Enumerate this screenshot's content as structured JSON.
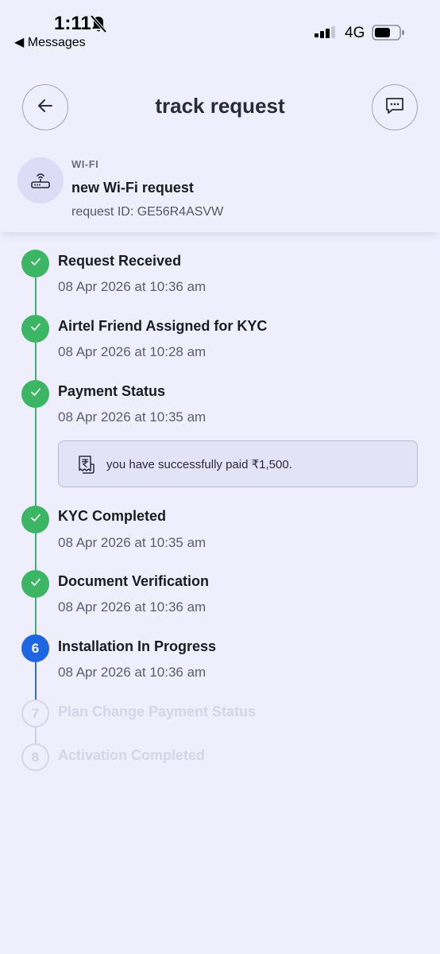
{
  "status_bar": {
    "time": "1:11",
    "back_app": "◀ Messages",
    "network": "4G"
  },
  "header": {
    "title": "track request"
  },
  "request": {
    "category": "WI-FI",
    "name": "new Wi-Fi request",
    "request_id": "request ID: GE56R4ASVW"
  },
  "steps": [
    {
      "number": "1",
      "title": "Request Received",
      "time": "08 Apr 2026 at 10:36 am",
      "state": "done"
    },
    {
      "number": "2",
      "title": "Airtel Friend Assigned for KYC",
      "time": "08 Apr 2026 at 10:28 am",
      "state": "done"
    },
    {
      "number": "3",
      "title": "Payment Status",
      "time": "08 Apr 2026 at 10:35 am",
      "state": "done"
    },
    {
      "number": "4",
      "title": "KYC Completed",
      "time": "08 Apr 2026 at 10:35 am",
      "state": "done"
    },
    {
      "number": "5",
      "title": "Document Verification",
      "time": "08 Apr 2026 at 10:36 am",
      "state": "done"
    },
    {
      "number": "6",
      "title": "Installation In Progress",
      "time": "08 Apr 2026 at 10:36 am",
      "state": "active"
    },
    {
      "number": "7",
      "title": "Plan Change Payment Status",
      "state": "pending"
    },
    {
      "number": "8",
      "title": "Activation Completed",
      "state": "pending"
    }
  ],
  "payment": {
    "message": "you have successfully paid ₹1,500."
  },
  "colors": {
    "background": "#eeeefc",
    "done": "#3cb565",
    "active": "#1f64e0",
    "pending": "#d4d5e6"
  }
}
